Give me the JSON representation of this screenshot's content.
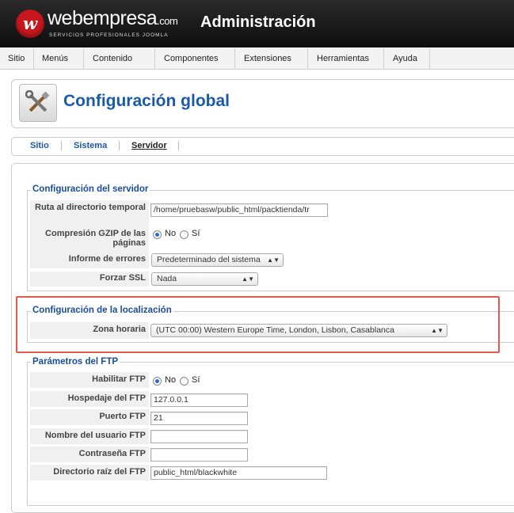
{
  "header": {
    "logo_letter": "w",
    "brand": "webempresa",
    "brand_suffix": ".com",
    "tagline": "SERVICIOS PROFESIONALES JOOMLA",
    "title": "Administración"
  },
  "menu": [
    "Sitio",
    "Menús",
    "Contenido",
    "Componentes",
    "Extensiones",
    "Herramientas",
    "Ayuda"
  ],
  "page": {
    "title": "Configuración global",
    "icon": "tools-icon"
  },
  "subnav": [
    "Sitio",
    "Sistema",
    "Servidor"
  ],
  "subnav_active": "Servidor",
  "server": {
    "legend": "Configuración del servidor",
    "temp_label": "Ruta al directorio temporal",
    "temp_value": "/home/pruebasw/public_html/packtienda/tr",
    "gzip_label": "Compresión GZIP de las páginas",
    "gzip_no": "No",
    "gzip_yes": "Sí",
    "gzip_selected": "No",
    "errors_label": "Informe de errores",
    "errors_value": "Predeterminado del sistema",
    "ssl_label": "Forzar SSL",
    "ssl_value": "Nada"
  },
  "locale": {
    "legend": "Configuración de la localización",
    "tz_label": "Zona horaria",
    "tz_value": "(UTC 00:00) Western Europe Time, London, Lisbon, Casablanca",
    "highlight_color": "#e05a4d"
  },
  "ftp": {
    "legend": "Parámetros del FTP",
    "enable_label": "Habilitar FTP",
    "enable_no": "No",
    "enable_yes": "Sí",
    "enable_selected": "No",
    "host_label": "Hospedaje del FTP",
    "host_value": "127.0.0.1",
    "port_label": "Puerto FTP",
    "port_value": "21",
    "user_label": "Nombre del usuario FTP",
    "user_value": "",
    "pass_label": "Contraseña FTP",
    "pass_value": "",
    "root_label": "Directorio raíz del FTP",
    "root_value": "public_html/blackwhite"
  },
  "colors": {
    "accent": "#1a5aa8",
    "brand_red": "#c8171e"
  }
}
